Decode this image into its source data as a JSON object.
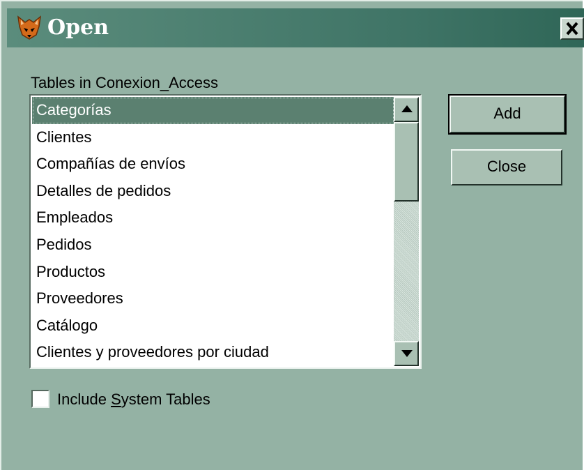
{
  "window": {
    "title": "Open",
    "close_glyph": "×",
    "app_icon": "fox-icon"
  },
  "tables_label": "Tables in Conexion_Access",
  "tables": [
    "Categorías",
    "Clientes",
    "Compañías de envíos",
    "Detalles de pedidos",
    "Empleados",
    "Pedidos",
    "Productos",
    "Proveedores",
    "Catálogo",
    "Clientes y proveedores por ciudad"
  ],
  "selected_table": "Categorías",
  "buttons": {
    "add": "Add",
    "close": "Close"
  },
  "include_system_tables": {
    "label_before": "Include ",
    "label_mnemonic": "S",
    "label_after": "ystem Tables",
    "checked": false
  },
  "colors": {
    "dialog_bg": "#94b2a4",
    "title_gradient_start": "#5b8c7c",
    "title_gradient_end": "#2f6657",
    "selection_bg": "#5b8070"
  }
}
